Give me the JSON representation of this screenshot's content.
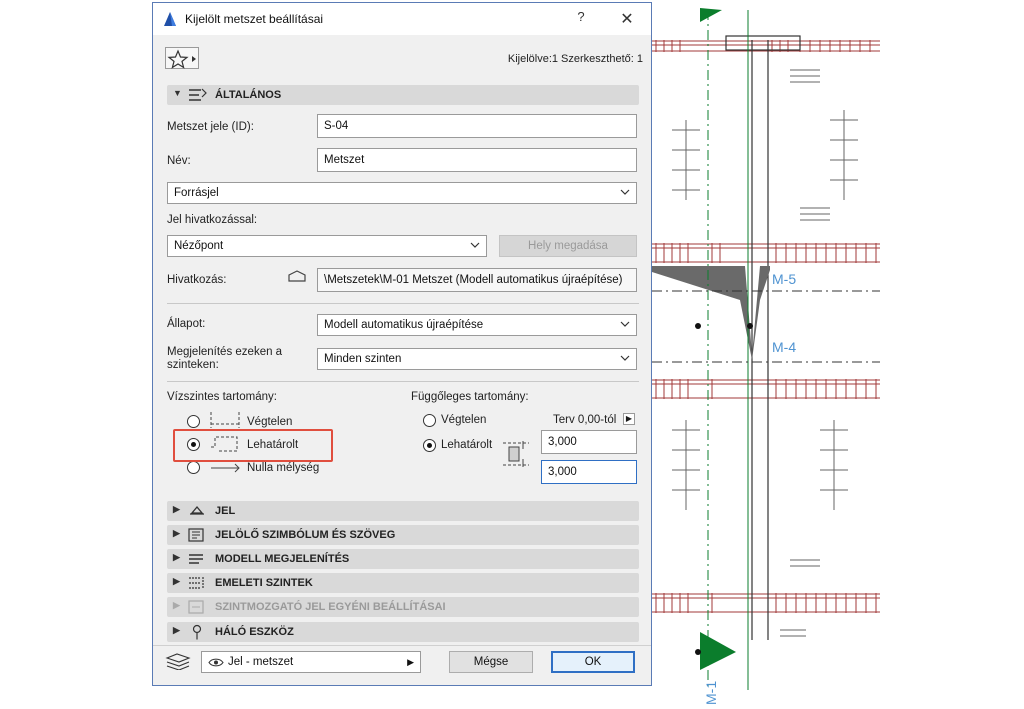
{
  "dialog": {
    "title": "Kijelölt metszet beállításai",
    "help_label": "?",
    "close_label": "✕",
    "selection_info": "Kijelölve:1 Szerkeszthető: 1"
  },
  "general": {
    "header": "ÁLTALÁNOS",
    "id_label": "Metszet jele (ID):",
    "id_value": "S-04",
    "name_label": "Név:",
    "name_value": "Metszet",
    "marker_type": "Forrásjel",
    "ref_label": "Jel hivatkozással:",
    "ref_value": "Nézőpont",
    "ref_button": "Hely megadása",
    "link_label": "Hivatkozás:",
    "link_value": "\\Metszetek\\M-01 Metszet (Modell automatikus újraépítése)",
    "status_label": "Állapot:",
    "status_value": "Modell automatikus újraépítése",
    "show_on_label": "Megjelenítés ezeken a szinteken:",
    "show_on_value": "Minden szinten"
  },
  "horizontal": {
    "title": "Vízszintes tartomány:",
    "options": [
      "Végtelen",
      "Lehatárolt",
      "Nulla mélység"
    ],
    "selected": "Lehatárolt"
  },
  "vertical": {
    "title": "Függőleges tartomány:",
    "options": [
      "Végtelen",
      "Lehatárolt"
    ],
    "selected": "Lehatárolt",
    "ref_label": "Terv 0,00-tól",
    "top_value": "3,000",
    "bottom_value": "3,000"
  },
  "sections": [
    {
      "label": "JEL",
      "icon": "marker-icon",
      "enabled": true
    },
    {
      "label": "JELÖLŐ SZIMBÓLUM ÉS SZÖVEG",
      "icon": "symbol-text-icon",
      "enabled": true
    },
    {
      "label": "MODELL MEGJELENÍTÉS",
      "icon": "model-display-icon",
      "enabled": true
    },
    {
      "label": "EMELETI SZINTEK",
      "icon": "stories-icon",
      "enabled": true
    },
    {
      "label": "SZINTMOZGATÓ JEL EGYÉNI BEÁLLÍTÁSAI",
      "icon": "level-marker-icon",
      "enabled": false
    },
    {
      "label": "HÁLÓ ESZKÖZ",
      "icon": "grid-tool-icon",
      "enabled": true
    }
  ],
  "footer": {
    "layer_value": "Jel - metszet",
    "cancel": "Mégse",
    "ok": "OK"
  },
  "drawing": {
    "labels": [
      "M-5",
      "M-4",
      "M-1"
    ]
  },
  "colors": {
    "accent": "#2f6fc4",
    "highlight": "#e04e3e",
    "section_label": "#4f93d1",
    "marker_green": "#0b7d2c",
    "drawing_red": "#a23a3a"
  }
}
